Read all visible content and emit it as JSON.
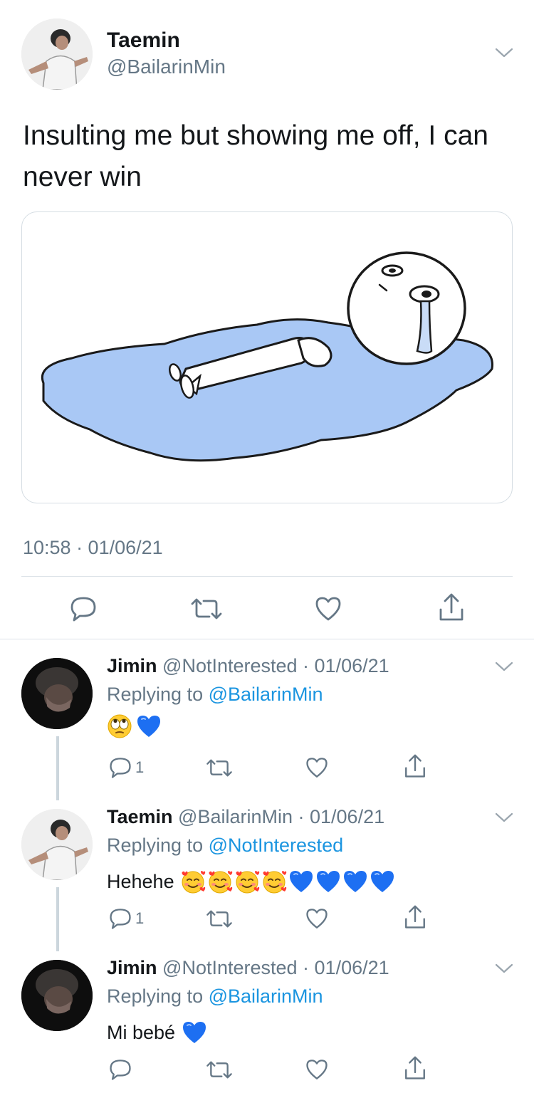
{
  "main_tweet": {
    "name": "Taemin",
    "handle": "@BailarinMin",
    "text": "Insulting me but showing me off, I can never win",
    "timestamp": "10:58 · 01/06/21",
    "image_alt": "cartoon crying in puddle"
  },
  "replies": [
    {
      "name": "Jimin",
      "meta": "@NotInterested · 01/06/21",
      "replying_prefix": "Replying to ",
      "replying_to": "@BailarinMin",
      "text": "",
      "emojis": [
        "eye-roll",
        "blue-heart"
      ],
      "reply_count": "1"
    },
    {
      "name": "Taemin",
      "meta": "@BailarinMin · 01/06/21",
      "replying_prefix": "Replying to ",
      "replying_to": "@NotInterested",
      "text": "Hehehe",
      "emojis": [
        "smiling-hearts",
        "smiling-hearts",
        "smiling-hearts",
        "smiling-hearts",
        "blue-heart",
        "blue-heart",
        "blue-heart",
        "blue-heart"
      ],
      "reply_count": "1"
    },
    {
      "name": "Jimin",
      "meta": "@NotInterested · 01/06/21",
      "replying_prefix": "Replying to ",
      "replying_to": "@BailarinMin",
      "text": "Mi bebé",
      "emojis": [
        "blue-heart"
      ],
      "reply_count": ""
    }
  ],
  "icons": {
    "reply": "speech-bubble-icon",
    "retweet": "retweet-icon",
    "like": "heart-icon",
    "share": "share-icon",
    "more": "chevron-down-icon"
  },
  "colors": {
    "link": "#1b95e0",
    "muted": "#657786",
    "heart_blue": "#1d6ff2",
    "puddle": "#a9c8f5"
  }
}
